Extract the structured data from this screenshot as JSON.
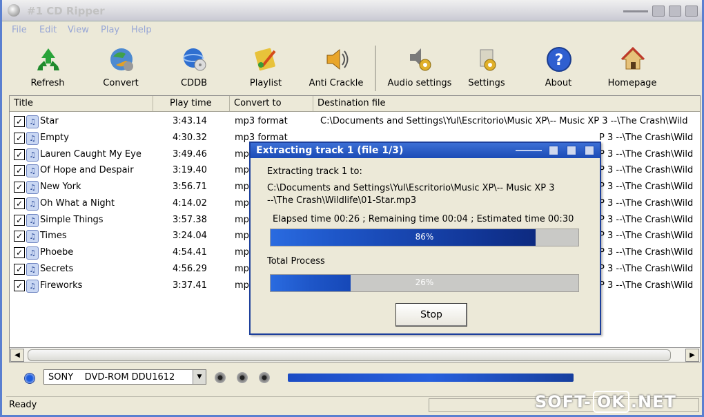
{
  "app": {
    "title": "#1 CD Ripper"
  },
  "menu": [
    "File",
    "Edit",
    "View",
    "Play",
    "Help"
  ],
  "toolbar": [
    {
      "label": "Refresh",
      "icon": "recycle-icon"
    },
    {
      "label": "Convert",
      "icon": "convert-icon"
    },
    {
      "label": "CDDB",
      "icon": "cddb-globe-icon"
    },
    {
      "label": "Playlist",
      "icon": "playlist-icon"
    },
    {
      "label": "Anti Crackle",
      "icon": "speaker-icon"
    },
    {
      "label": "Audio settings",
      "icon": "audio-settings-icon"
    },
    {
      "label": "Settings",
      "icon": "settings-icon"
    },
    {
      "label": "About",
      "icon": "help-icon"
    },
    {
      "label": "Homepage",
      "icon": "home-icon"
    }
  ],
  "columns": [
    "Title",
    "Play time",
    "Convert to",
    "Destination file"
  ],
  "tracks": [
    {
      "title": "Star",
      "time": "3:43.14",
      "format": "mp3 format",
      "dest": "C:\\Documents and Settings\\Yul\\Escritorio\\Music XP\\-- Music XP 3 --\\The Crash\\Wild"
    },
    {
      "title": "Empty",
      "time": "4:30.32",
      "format": "mp3 format",
      "dest": "P 3 --\\The Crash\\Wild"
    },
    {
      "title": "Lauren Caught My Eye",
      "time": "3:49.46",
      "format": "mp",
      "dest": "P 3 --\\The Crash\\Wild"
    },
    {
      "title": "Of Hope and Despair",
      "time": "3:19.40",
      "format": "mp",
      "dest": "P 3 --\\The Crash\\Wild"
    },
    {
      "title": "New York",
      "time": "3:56.71",
      "format": "mp",
      "dest": "P 3 --\\The Crash\\Wild"
    },
    {
      "title": "Oh What a Night",
      "time": "4:14.02",
      "format": "mp",
      "dest": "P 3 --\\The Crash\\Wild"
    },
    {
      "title": "Simple Things",
      "time": "3:57.38",
      "format": "mp",
      "dest": "P 3 --\\The Crash\\Wild"
    },
    {
      "title": "Times",
      "time": "3:24.04",
      "format": "mp",
      "dest": "P 3 --\\The Crash\\Wild"
    },
    {
      "title": "Phoebe",
      "time": "4:54.41",
      "format": "mp",
      "dest": "P 3 --\\The Crash\\Wild"
    },
    {
      "title": "Secrets",
      "time": "4:56.29",
      "format": "mp",
      "dest": "P 3 --\\The Crash\\Wild"
    },
    {
      "title": "Fireworks",
      "time": "3:37.41",
      "format": "mp",
      "dest": "P 3 --\\The Crash\\Wild"
    }
  ],
  "dialog": {
    "title": "Extracting track 1 (file 1/3)",
    "line1": "Extracting track 1 to:",
    "path1": "C:\\Documents and Settings\\Yul\\Escritorio\\Music XP\\-- Music XP 3",
    "path2": "--\\The Crash\\Wildlife\\01-Star.mp3",
    "times": "Elapsed time 00:26 ; Remaining time 00:04 ; Estimated time 00:30",
    "track_progress": 0.86,
    "track_progress_label": "86%",
    "total_label": "Total Process",
    "total_progress": 0.26,
    "total_progress_label": "26%",
    "stop_label": "Stop"
  },
  "drive": {
    "name": "SONY    DVD-ROM DDU1612"
  },
  "status": {
    "text": "Ready"
  },
  "watermark": {
    "text1": "SOFT-",
    "text2": "OK",
    "text3": ".NET"
  }
}
